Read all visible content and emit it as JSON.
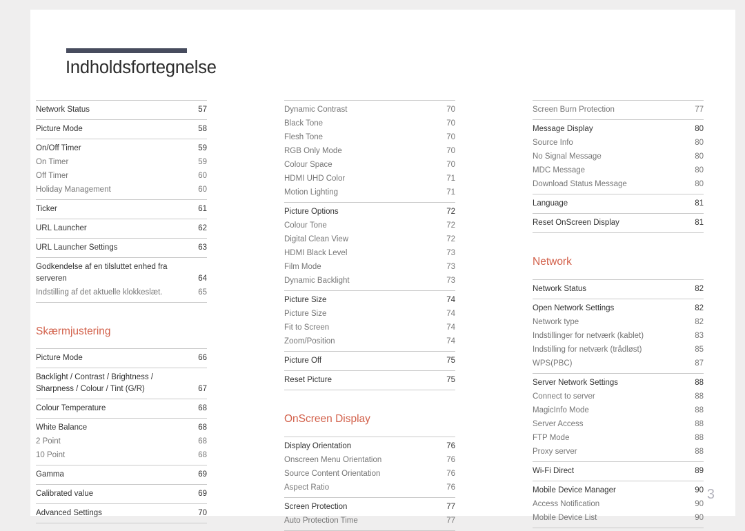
{
  "document": {
    "title": "Indholdsfortegnelse",
    "folio": "3",
    "accent_color": "#d2604a",
    "rule_color": "#474c5e"
  },
  "columns": [
    {
      "name": "column-left",
      "sections": [
        {
          "heading": null,
          "groups": [
            {
              "entries": [
                {
                  "label": "Network Status",
                  "page": "57",
                  "level": 1
                }
              ]
            },
            {
              "entries": [
                {
                  "label": "Picture Mode",
                  "page": "58",
                  "level": 1
                }
              ]
            },
            {
              "entries": [
                {
                  "label": "On/Off Timer",
                  "page": "59",
                  "level": 1
                },
                {
                  "label": "On Timer",
                  "page": "59",
                  "level": 2
                },
                {
                  "label": "Off Timer",
                  "page": "60",
                  "level": 2
                },
                {
                  "label": "Holiday Management",
                  "page": "60",
                  "level": 2
                }
              ]
            },
            {
              "entries": [
                {
                  "label": "Ticker",
                  "page": "61",
                  "level": 1
                }
              ]
            },
            {
              "entries": [
                {
                  "label": "URL Launcher",
                  "page": "62",
                  "level": 1
                }
              ]
            },
            {
              "entries": [
                {
                  "label": "URL Launcher Settings",
                  "page": "63",
                  "level": 1
                }
              ]
            },
            {
              "entries": [
                {
                  "label": "Godkendelse af en tilsluttet enhed fra serveren",
                  "page": "64",
                  "level": 1
                },
                {
                  "label": "Indstilling af det aktuelle klokkeslæt.",
                  "page": "65",
                  "level": 2
                }
              ]
            }
          ]
        },
        {
          "heading": "Skærmjustering",
          "groups": [
            {
              "entries": [
                {
                  "label": "Picture Mode",
                  "page": "66",
                  "level": 1
                }
              ]
            },
            {
              "entries": [
                {
                  "label": "Backlight / Contrast / Brightness / Sharpness / Colour / Tint (G/R)",
                  "page": "67",
                  "level": 1
                }
              ]
            },
            {
              "entries": [
                {
                  "label": "Colour Temperature",
                  "page": "68",
                  "level": 1
                }
              ]
            },
            {
              "entries": [
                {
                  "label": "White Balance",
                  "page": "68",
                  "level": 1
                },
                {
                  "label": "2 Point",
                  "page": "68",
                  "level": 2
                },
                {
                  "label": "10 Point",
                  "page": "68",
                  "level": 2
                }
              ]
            },
            {
              "entries": [
                {
                  "label": "Gamma",
                  "page": "69",
                  "level": 1
                }
              ]
            },
            {
              "entries": [
                {
                  "label": "Calibrated value",
                  "page": "69",
                  "level": 1
                }
              ]
            },
            {
              "entries": [
                {
                  "label": "Advanced Settings",
                  "page": "70",
                  "level": 1
                }
              ]
            }
          ]
        }
      ]
    },
    {
      "name": "column-middle",
      "sections": [
        {
          "heading": null,
          "groups": [
            {
              "entries": [
                {
                  "label": "Dynamic Contrast",
                  "page": "70",
                  "level": 2
                },
                {
                  "label": "Black Tone",
                  "page": "70",
                  "level": 2
                },
                {
                  "label": "Flesh Tone",
                  "page": "70",
                  "level": 2
                },
                {
                  "label": "RGB Only Mode",
                  "page": "70",
                  "level": 2
                },
                {
                  "label": "Colour Space",
                  "page": "70",
                  "level": 2
                },
                {
                  "label": "HDMI UHD Color",
                  "page": "71",
                  "level": 2
                },
                {
                  "label": "Motion Lighting",
                  "page": "71",
                  "level": 2
                }
              ]
            },
            {
              "entries": [
                {
                  "label": "Picture Options",
                  "page": "72",
                  "level": 1
                },
                {
                  "label": "Colour Tone",
                  "page": "72",
                  "level": 2
                },
                {
                  "label": "Digital Clean View",
                  "page": "72",
                  "level": 2
                },
                {
                  "label": "HDMI Black Level",
                  "page": "73",
                  "level": 2
                },
                {
                  "label": "Film Mode",
                  "page": "73",
                  "level": 2
                },
                {
                  "label": "Dynamic Backlight",
                  "page": "73",
                  "level": 2
                }
              ]
            },
            {
              "entries": [
                {
                  "label": "Picture Size",
                  "page": "74",
                  "level": 1
                },
                {
                  "label": "Picture Size",
                  "page": "74",
                  "level": 2
                },
                {
                  "label": "Fit to Screen",
                  "page": "74",
                  "level": 2
                },
                {
                  "label": "Zoom/Position",
                  "page": "74",
                  "level": 2
                }
              ]
            },
            {
              "entries": [
                {
                  "label": "Picture Off",
                  "page": "75",
                  "level": 1
                }
              ]
            },
            {
              "entries": [
                {
                  "label": "Reset Picture",
                  "page": "75",
                  "level": 1
                }
              ]
            }
          ]
        },
        {
          "heading": "OnScreen Display",
          "groups": [
            {
              "entries": [
                {
                  "label": "Display Orientation",
                  "page": "76",
                  "level": 1
                },
                {
                  "label": "Onscreen Menu Orientation",
                  "page": "76",
                  "level": 2
                },
                {
                  "label": "Source Content Orientation",
                  "page": "76",
                  "level": 2
                },
                {
                  "label": "Aspect Ratio",
                  "page": "76",
                  "level": 2
                }
              ]
            },
            {
              "entries": [
                {
                  "label": "Screen Protection",
                  "page": "77",
                  "level": 1
                },
                {
                  "label": "Auto Protection Time",
                  "page": "77",
                  "level": 2
                }
              ]
            }
          ]
        }
      ]
    },
    {
      "name": "column-right",
      "sections": [
        {
          "heading": null,
          "groups": [
            {
              "entries": [
                {
                  "label": "Screen Burn Protection",
                  "page": "77",
                  "level": 2
                }
              ]
            },
            {
              "entries": [
                {
                  "label": "Message Display",
                  "page": "80",
                  "level": 1
                },
                {
                  "label": "Source Info",
                  "page": "80",
                  "level": 2
                },
                {
                  "label": "No Signal Message",
                  "page": "80",
                  "level": 2
                },
                {
                  "label": "MDC Message",
                  "page": "80",
                  "level": 2
                },
                {
                  "label": "Download Status Message",
                  "page": "80",
                  "level": 2
                }
              ]
            },
            {
              "entries": [
                {
                  "label": "Language",
                  "page": "81",
                  "level": 1
                }
              ]
            },
            {
              "entries": [
                {
                  "label": "Reset OnScreen Display",
                  "page": "81",
                  "level": 1
                }
              ]
            }
          ]
        },
        {
          "heading": "Network",
          "groups": [
            {
              "entries": [
                {
                  "label": "Network Status",
                  "page": "82",
                  "level": 1
                }
              ]
            },
            {
              "entries": [
                {
                  "label": "Open Network Settings",
                  "page": "82",
                  "level": 1
                },
                {
                  "label": "Network type",
                  "page": "82",
                  "level": 2
                },
                {
                  "label": "Indstillinger for netværk (kablet)",
                  "page": "83",
                  "level": 2
                },
                {
                  "label": "Indstilling for netværk (trådløst)",
                  "page": "85",
                  "level": 2
                },
                {
                  "label": "WPS(PBC)",
                  "page": "87",
                  "level": 2
                }
              ]
            },
            {
              "entries": [
                {
                  "label": "Server Network Settings",
                  "page": "88",
                  "level": 1
                },
                {
                  "label": "Connect to server",
                  "page": "88",
                  "level": 2
                },
                {
                  "label": "MagicInfo Mode",
                  "page": "88",
                  "level": 2
                },
                {
                  "label": "Server Access",
                  "page": "88",
                  "level": 2
                },
                {
                  "label": "FTP Mode",
                  "page": "88",
                  "level": 2
                },
                {
                  "label": "Proxy server",
                  "page": "88",
                  "level": 2
                }
              ]
            },
            {
              "entries": [
                {
                  "label": "Wi-Fi Direct",
                  "page": "89",
                  "level": 1
                }
              ]
            },
            {
              "entries": [
                {
                  "label": "Mobile Device Manager",
                  "page": "90",
                  "level": 1
                },
                {
                  "label": "Access Notification",
                  "page": "90",
                  "level": 2
                },
                {
                  "label": "Mobile Device List",
                  "page": "90",
                  "level": 2
                }
              ]
            }
          ]
        }
      ]
    }
  ]
}
